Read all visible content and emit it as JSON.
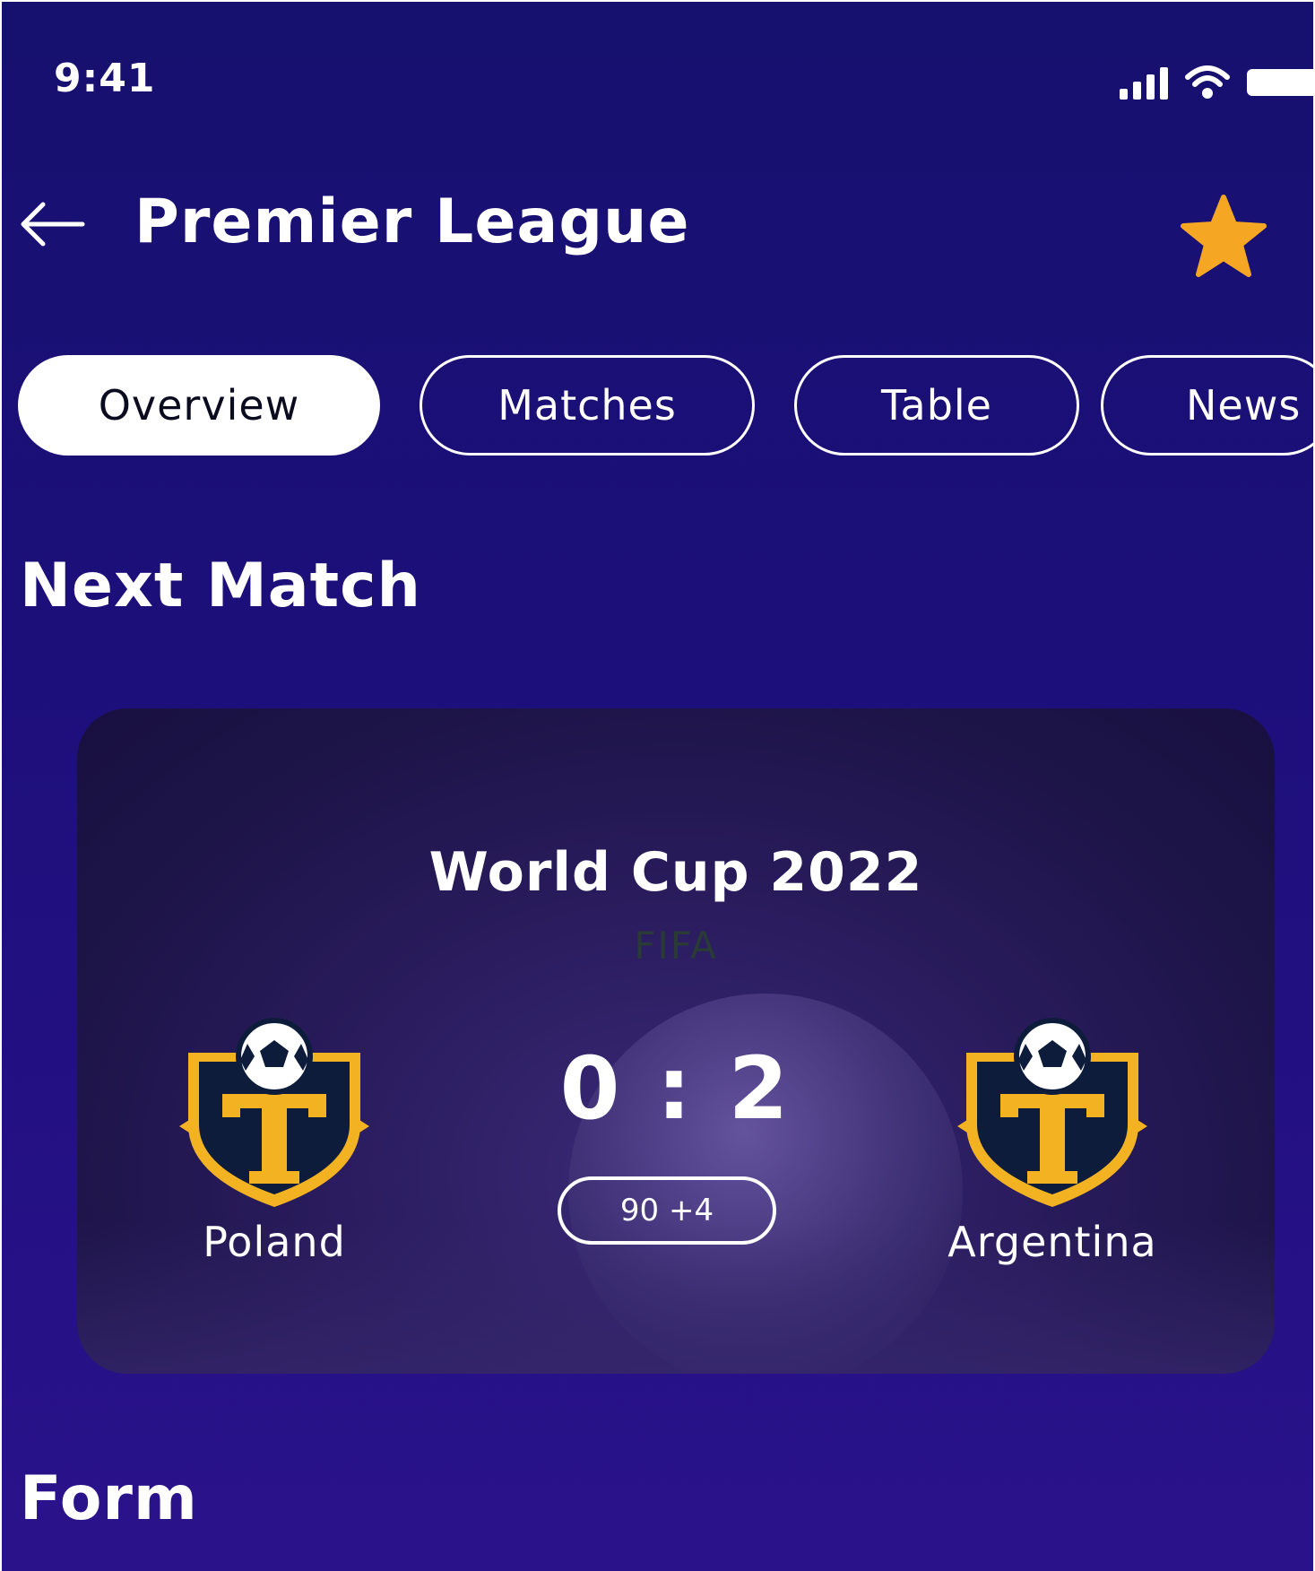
{
  "status_bar": {
    "time": "9:41",
    "icons": [
      "signal-icon",
      "wifi-icon",
      "battery-icon"
    ]
  },
  "header": {
    "title": "Premier League",
    "back_icon": "arrow-left-icon",
    "favorite_icon": "star-icon",
    "favorite_color": "#f5a623"
  },
  "tabs": [
    {
      "label": "Overview",
      "active": true
    },
    {
      "label": "Matches",
      "active": false
    },
    {
      "label": "Table",
      "active": false
    },
    {
      "label": "News",
      "active": false
    }
  ],
  "next_match": {
    "section_title": "Next Match",
    "competition": "World Cup 2022",
    "organizer": "FIFA",
    "home_team": {
      "name": "Poland",
      "crest_icon": "team-crest-icon"
    },
    "away_team": {
      "name": "Argentina",
      "crest_icon": "team-crest-icon"
    },
    "score": "0 : 2",
    "minute": "90 +4"
  },
  "form": {
    "section_title": "Form"
  },
  "colors": {
    "background": "#1c0f7a",
    "accent": "#f5a623",
    "crest_gold": "#f2b222",
    "crest_navy": "#0d1c3a"
  }
}
